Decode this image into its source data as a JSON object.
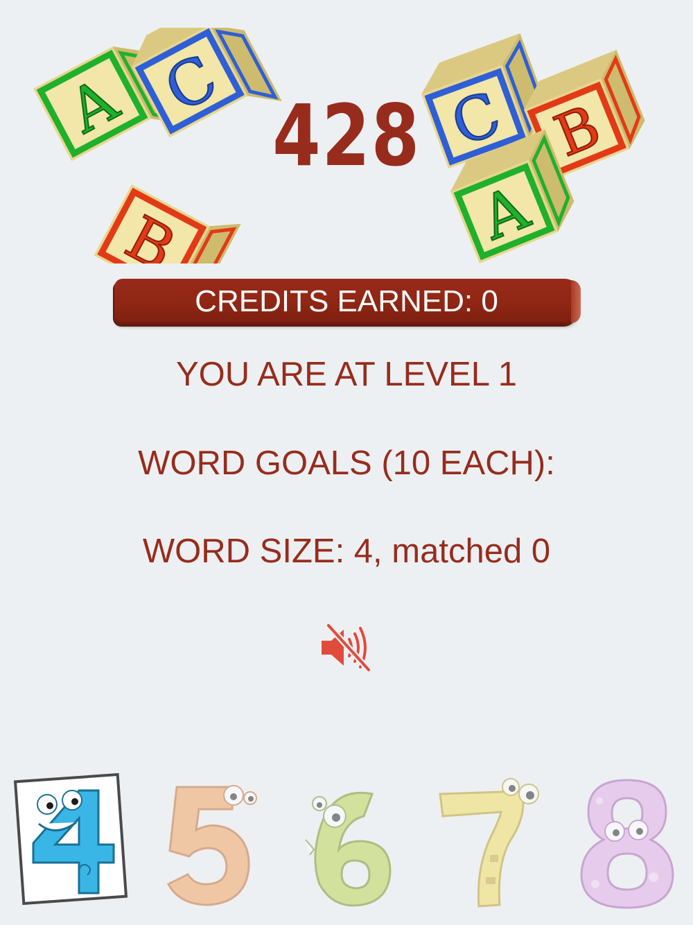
{
  "score": "428",
  "credits": {
    "label": "CREDITS EARNED: 0"
  },
  "level_text": "YOU ARE AT LEVEL 1",
  "goals_text": "WORD GOALS (10 EACH):",
  "word_size_text": "WORD SIZE: 4, matched 0",
  "sound": {
    "icon": "speaker-muted-icon",
    "muted": true,
    "color": "#e14b3c"
  },
  "word_sizes": [
    {
      "digit": "4",
      "selected": true,
      "color": "#39b6e6"
    },
    {
      "digit": "5",
      "selected": false,
      "color": "#f4a05a"
    },
    {
      "digit": "6",
      "selected": false,
      "color": "#b8d64a"
    },
    {
      "digit": "7",
      "selected": false,
      "color": "#f2dc5a"
    },
    {
      "digit": "8",
      "selected": false,
      "color": "#e2a8ea"
    }
  ],
  "blocks": {
    "letters": [
      "A",
      "B",
      "C"
    ],
    "colors": {
      "A": "#1fb02c",
      "B": "#e23a16",
      "C": "#2f5fd6",
      "wood": "#efe2a0"
    }
  },
  "colors": {
    "background": "#edf0f2",
    "accent": "#972c1d",
    "banner_text": "#ffffff"
  }
}
